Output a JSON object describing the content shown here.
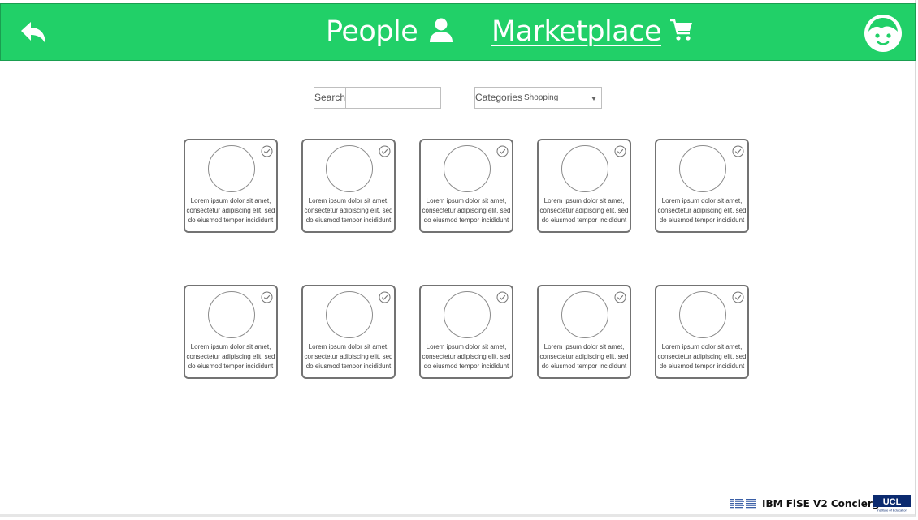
{
  "header": {
    "nav_people": "People",
    "nav_marketplace": "Marketplace",
    "icons": [
      "back-arrow-icon",
      "person-icon",
      "shopping-cart-icon",
      "avatar-face-icon"
    ],
    "bar_color": "#21d068"
  },
  "filters": {
    "search_label": "Search",
    "search_value": "",
    "categories_label": "Categories",
    "category_selected": "Shopping"
  },
  "cards": [
    {
      "text": "Lorem ipsum dolor sit amet, consectetur adipiscing elit, sed do eiusmod tempor incididunt"
    },
    {
      "text": "Lorem ipsum dolor sit amet, consectetur adipiscing elit, sed do eiusmod tempor incididunt"
    },
    {
      "text": "Lorem ipsum dolor sit amet, consectetur adipiscing elit, sed do eiusmod tempor incididunt"
    },
    {
      "text": "Lorem ipsum dolor sit amet, consectetur adipiscing elit, sed do eiusmod tempor incididunt"
    },
    {
      "text": "Lorem ipsum dolor sit amet, consectetur adipiscing elit, sed do eiusmod tempor incididunt"
    },
    {
      "text": "Lorem ipsum dolor sit amet, consectetur adipiscing elit, sed do eiusmod tempor incididunt"
    },
    {
      "text": "Lorem ipsum dolor sit amet, consectetur adipiscing elit, sed do eiusmod tempor incididunt"
    },
    {
      "text": "Lorem ipsum dolor sit amet, consectetur adipiscing elit, sed do eiusmod tempor incididunt"
    },
    {
      "text": "Lorem ipsum dolor sit amet, consectetur adipiscing elit, sed do eiusmod tempor incididunt"
    },
    {
      "text": "Lorem ipsum dolor sit amet, consectetur adipiscing elit, sed do eiusmod tempor incididunt"
    }
  ],
  "footer": {
    "title": "IBM FiSE V2 Concierge",
    "ibm_logo_text": "IBM",
    "ucl_logo_text": "UCL",
    "ucl_logo_subtext": "Institute of Education"
  }
}
